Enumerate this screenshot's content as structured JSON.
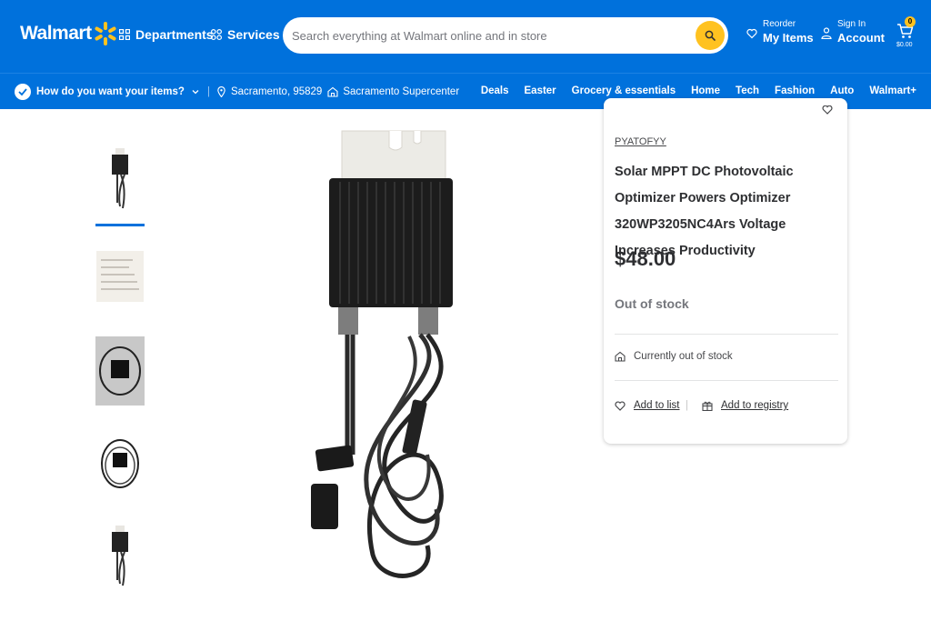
{
  "header": {
    "logo_text": "Walmart",
    "departments": "Departments",
    "services": "Services",
    "search_placeholder": "Search everything at Walmart online and in store",
    "reorder_small": "Reorder",
    "reorder_big": "My Items",
    "signin_small": "Sign In",
    "signin_big": "Account",
    "cart_count": "0",
    "cart_total": "$0.00"
  },
  "subnav": {
    "prompt": "How do you want your items?",
    "location": "Sacramento, 95829",
    "store": "Sacramento Supercenter",
    "links": [
      "Deals",
      "Easter",
      "Grocery & essentials",
      "Home",
      "Tech",
      "Fashion",
      "Auto",
      "Walmart+"
    ]
  },
  "product": {
    "brand": "PYATOFYY",
    "title": "Solar MPPT DC Photovoltaic Optimizer Powers Optimizer 320WP3205NC4Ars Voltage Increases Productivity",
    "price": "$48.00",
    "availability": "Out of stock",
    "store_status": "Currently out of stock",
    "add_to_list": "Add to list",
    "add_to_registry": "Add to registry"
  },
  "colors": {
    "brand_blue": "#0071dc",
    "spark_yellow": "#ffc220"
  }
}
